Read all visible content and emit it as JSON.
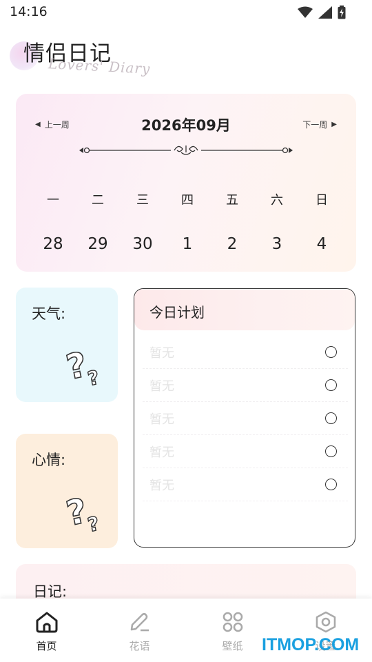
{
  "status_bar": {
    "time": "14:16"
  },
  "header": {
    "title": "情侣日记",
    "subtitle": "Lovers' Diary"
  },
  "calendar": {
    "prev_week": "上一周",
    "next_week": "下一周",
    "month": "2026年09月",
    "weekdays": [
      "一",
      "二",
      "三",
      "四",
      "五",
      "六",
      "日"
    ],
    "dates": [
      "28",
      "29",
      "30",
      "1",
      "2",
      "3",
      "4"
    ]
  },
  "weather": {
    "label": "天气:"
  },
  "mood": {
    "label": "心情:"
  },
  "plan": {
    "title": "今日计划",
    "items": [
      "暂无",
      "暂无",
      "暂无",
      "暂无",
      "暂无"
    ]
  },
  "diary": {
    "label": "日记:"
  },
  "nav": {
    "items": [
      {
        "label": "首页",
        "icon": "home-icon"
      },
      {
        "label": "花语",
        "icon": "pen-icon"
      },
      {
        "label": "壁纸",
        "icon": "grid-icon"
      },
      {
        "label": "设置",
        "icon": "settings-icon"
      }
    ]
  },
  "watermark": "ITMOP.COM",
  "colors": {
    "weather_bg": "#e8f8fc",
    "mood_bg": "#fdeedd",
    "watermark": "#1aa0e0"
  }
}
